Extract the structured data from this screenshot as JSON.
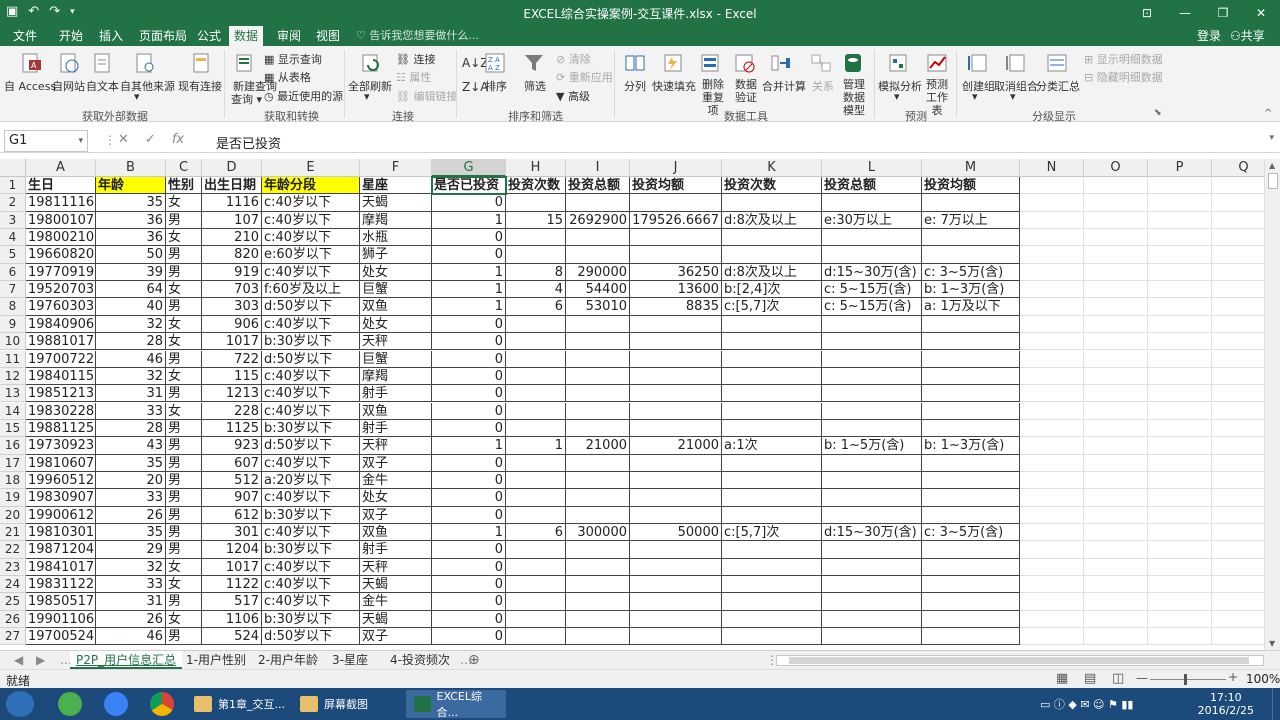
{
  "window": {
    "title": "EXCEL综合实操案例-交互课件.xlsx - Excel"
  },
  "ribbon_tabs": [
    "文件",
    "开始",
    "插入",
    "页面布局",
    "公式",
    "数据",
    "审阅",
    "视图"
  ],
  "active_tab": "数据",
  "tell_me": "告诉我您想要做什么...",
  "login": "登录",
  "share": "共享",
  "ribbon": {
    "get_external": {
      "name": "获取外部数据",
      "items": [
        "自 Access",
        "自网站",
        "自文本",
        "自其他来源",
        "现有连接"
      ]
    },
    "get_transform": {
      "name": "获取和转换",
      "new_query": "新建查询",
      "show_query": "显示查询",
      "from_table": "从表格",
      "recent": "最近使用的源"
    },
    "connections": {
      "name": "连接",
      "refresh_all": "全部刷新",
      "connections": "连接",
      "properties": "属性",
      "edit_links": "编辑链接"
    },
    "sort_filter": {
      "name": "排序和筛选",
      "sort": "排序",
      "filter": "筛选",
      "clear": "清除",
      "reapply": "重新应用",
      "advanced": "高级"
    },
    "data_tools": {
      "name": "数据工具",
      "items": [
        "分列",
        "快速填充",
        "删除重复项",
        "数据验证",
        "合并计算",
        "关系",
        "管理数据模型"
      ]
    },
    "forecast": {
      "name": "预测",
      "items": [
        "模拟分析",
        "预测工作表"
      ]
    },
    "outline": {
      "name": "分级显示",
      "items": [
        "创建组",
        "取消组合",
        "分类汇总"
      ],
      "show_detail": "显示明细数据",
      "hide_detail": "隐藏明细数据"
    }
  },
  "formula_bar": {
    "name_box": "G1",
    "content": "是否已投资"
  },
  "columns": [
    "A",
    "B",
    "C",
    "D",
    "E",
    "F",
    "G",
    "H",
    "I",
    "J",
    "K",
    "L",
    "M",
    "N",
    "O",
    "P",
    "Q"
  ],
  "rows": [
    [
      "生日",
      "年龄",
      "性别",
      "出生日期",
      "年龄分段",
      "星座",
      "是否已投资",
      "投资次数",
      "投资总额",
      "投资均额",
      "投资次数",
      "投资总额",
      "投资均额"
    ],
    [
      "19811116",
      "35",
      "女",
      "1116",
      "c:40岁以下",
      "天蝎",
      "0",
      "",
      "",
      "",
      "",
      "",
      ""
    ],
    [
      "19800107",
      "36",
      "男",
      "107",
      "c:40岁以下",
      "摩羯",
      "1",
      "15",
      "2692900",
      "179526.6667",
      "d:8次及以上",
      "e:30万以上",
      "e: 7万以上"
    ],
    [
      "19800210",
      "36",
      "女",
      "210",
      "c:40岁以下",
      "水瓶",
      "0",
      "",
      "",
      "",
      "",
      "",
      ""
    ],
    [
      "19660820",
      "50",
      "男",
      "820",
      "e:60岁以下",
      "狮子",
      "0",
      "",
      "",
      "",
      "",
      "",
      ""
    ],
    [
      "19770919",
      "39",
      "男",
      "919",
      "c:40岁以下",
      "处女",
      "1",
      "8",
      "290000",
      "36250",
      "d:8次及以上",
      "d:15~30万(含)",
      "c: 3~5万(含)"
    ],
    [
      "19520703",
      "64",
      "女",
      "703",
      "f:60岁及以上",
      "巨蟹",
      "1",
      "4",
      "54400",
      "13600",
      "b:[2,4]次",
      "c: 5~15万(含)",
      "b: 1~3万(含)"
    ],
    [
      "19760303",
      "40",
      "男",
      "303",
      "d:50岁以下",
      "双鱼",
      "1",
      "6",
      "53010",
      "8835",
      "c:[5,7]次",
      "c: 5~15万(含)",
      "a: 1万及以下"
    ],
    [
      "19840906",
      "32",
      "女",
      "906",
      "c:40岁以下",
      "处女",
      "0",
      "",
      "",
      "",
      "",
      "",
      ""
    ],
    [
      "19881017",
      "28",
      "女",
      "1017",
      "b:30岁以下",
      "天秤",
      "0",
      "",
      "",
      "",
      "",
      "",
      ""
    ],
    [
      "19700722",
      "46",
      "男",
      "722",
      "d:50岁以下",
      "巨蟹",
      "0",
      "",
      "",
      "",
      "",
      "",
      ""
    ],
    [
      "19840115",
      "32",
      "女",
      "115",
      "c:40岁以下",
      "摩羯",
      "0",
      "",
      "",
      "",
      "",
      "",
      ""
    ],
    [
      "19851213",
      "31",
      "男",
      "1213",
      "c:40岁以下",
      "射手",
      "0",
      "",
      "",
      "",
      "",
      "",
      ""
    ],
    [
      "19830228",
      "33",
      "女",
      "228",
      "c:40岁以下",
      "双鱼",
      "0",
      "",
      "",
      "",
      "",
      "",
      ""
    ],
    [
      "19881125",
      "28",
      "男",
      "1125",
      "b:30岁以下",
      "射手",
      "0",
      "",
      "",
      "",
      "",
      "",
      ""
    ],
    [
      "19730923",
      "43",
      "男",
      "923",
      "d:50岁以下",
      "天秤",
      "1",
      "1",
      "21000",
      "21000",
      "a:1次",
      "b: 1~5万(含)",
      "b: 1~3万(含)"
    ],
    [
      "19810607",
      "35",
      "男",
      "607",
      "c:40岁以下",
      "双子",
      "0",
      "",
      "",
      "",
      "",
      "",
      ""
    ],
    [
      "19960512",
      "20",
      "男",
      "512",
      "a:20岁以下",
      "金牛",
      "0",
      "",
      "",
      "",
      "",
      "",
      ""
    ],
    [
      "19830907",
      "33",
      "男",
      "907",
      "c:40岁以下",
      "处女",
      "0",
      "",
      "",
      "",
      "",
      "",
      ""
    ],
    [
      "19900612",
      "26",
      "男",
      "612",
      "b:30岁以下",
      "双子",
      "0",
      "",
      "",
      "",
      "",
      "",
      ""
    ],
    [
      "19810301",
      "35",
      "男",
      "301",
      "c:40岁以下",
      "双鱼",
      "1",
      "6",
      "300000",
      "50000",
      "c:[5,7]次",
      "d:15~30万(含)",
      "c: 3~5万(含)"
    ],
    [
      "19871204",
      "29",
      "男",
      "1204",
      "b:30岁以下",
      "射手",
      "0",
      "",
      "",
      "",
      "",
      "",
      ""
    ],
    [
      "19841017",
      "32",
      "女",
      "1017",
      "c:40岁以下",
      "天秤",
      "0",
      "",
      "",
      "",
      "",
      "",
      ""
    ],
    [
      "19831122",
      "33",
      "女",
      "1122",
      "c:40岁以下",
      "天蝎",
      "0",
      "",
      "",
      "",
      "",
      "",
      ""
    ],
    [
      "19850517",
      "31",
      "男",
      "517",
      "c:40岁以下",
      "金牛",
      "0",
      "",
      "",
      "",
      "",
      "",
      ""
    ],
    [
      "19901106",
      "26",
      "女",
      "1106",
      "b:30岁以下",
      "天蝎",
      "0",
      "",
      "",
      "",
      "",
      "",
      ""
    ],
    [
      "19700524",
      "46",
      "男",
      "524",
      "d:50岁以下",
      "双子",
      "0",
      "",
      "",
      "",
      "",
      "",
      ""
    ]
  ],
  "sheet_tabs": [
    "P2P_用户信息汇总",
    "1-用户性别",
    "2-用户年龄",
    "3-星座",
    "4-投资频次"
  ],
  "active_sheet": "P2P_用户信息汇总",
  "status": {
    "ready": "就绪",
    "zoom": "100%"
  },
  "taskbar": {
    "items": [
      "第1章_交互...",
      "屏幕截图",
      "EXCEL综合..."
    ],
    "time": "17:10",
    "date": "2016/2/25"
  },
  "colors": {
    "excel_green": "#217346",
    "header_yellow": "#ffff00",
    "taskbar": "#1c4a7a"
  }
}
